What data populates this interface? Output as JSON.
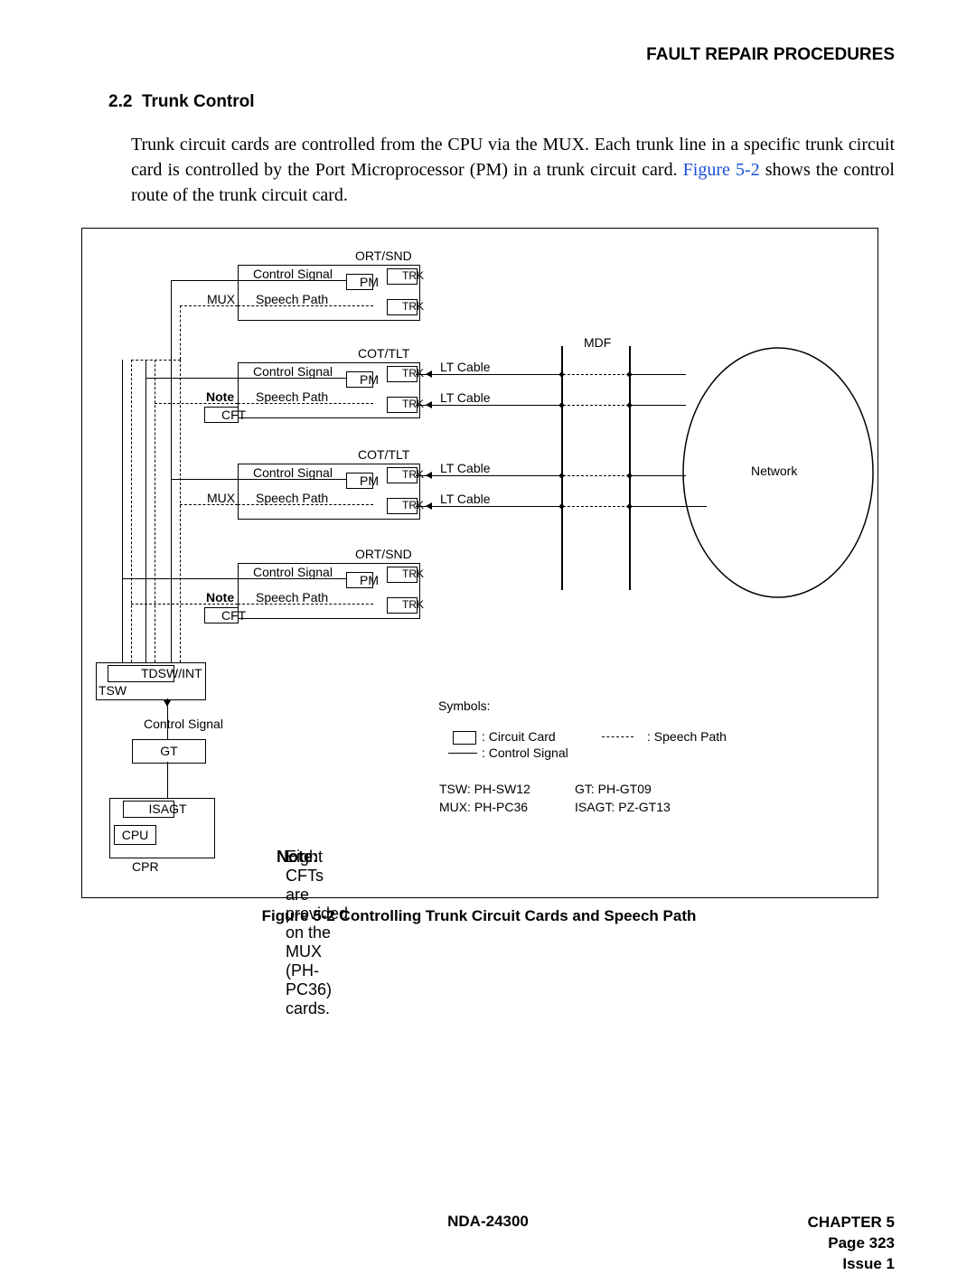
{
  "header": "FAULT REPAIR PROCEDURES",
  "section_no": "2.2",
  "section_title": "Trunk Control",
  "paragraph_pre": "Trunk circuit cards are controlled from the CPU via the MUX. Each trunk line in a specific trunk circuit card is controlled by the Port Microprocessor (PM) in a trunk circuit card. ",
  "figref": "Figure 5-2",
  "paragraph_post": " shows the control route of the trunk circuit card.",
  "fig": {
    "caption": "Figure 5-2   Controlling Trunk Circuit Cards and Speech Path",
    "labels": {
      "ort_snd": "ORT/SND",
      "cot_tlt": "COT/TLT",
      "control_signal": "Control Signal",
      "speech_path": "Speech Path",
      "mux": "MUX",
      "note": "Note",
      "cft": "CFT",
      "pm": "PM",
      "trk": "TRK",
      "lt_cable": "LT Cable",
      "mdf": "MDF",
      "network": "Network",
      "tdsw_int": "TDSW/INT",
      "tsw": "TSW",
      "gt": "GT",
      "isagt": "ISAGT",
      "cpu": "CPU",
      "cpr": "CPR"
    },
    "symbols": {
      "heading": "Symbols:",
      "circuit_card": ": Circuit Card",
      "control_signal": ": Control Signal",
      "speech_path": ": Speech Path",
      "tsw": "TSW:  PH-SW12",
      "mux": "MUX:  PH-PC36",
      "gt": "GT:  PH-GT09",
      "isagt": "ISAGT:  PZ-GT13"
    },
    "note_text": "Eight CFTs are provided on the MUX (PH-PC36) cards.",
    "note_prefix": "Note:"
  },
  "footer": {
    "doc": "NDA-24300",
    "chapter": "CHAPTER 5",
    "page": "Page 323",
    "issue": "Issue 1"
  }
}
